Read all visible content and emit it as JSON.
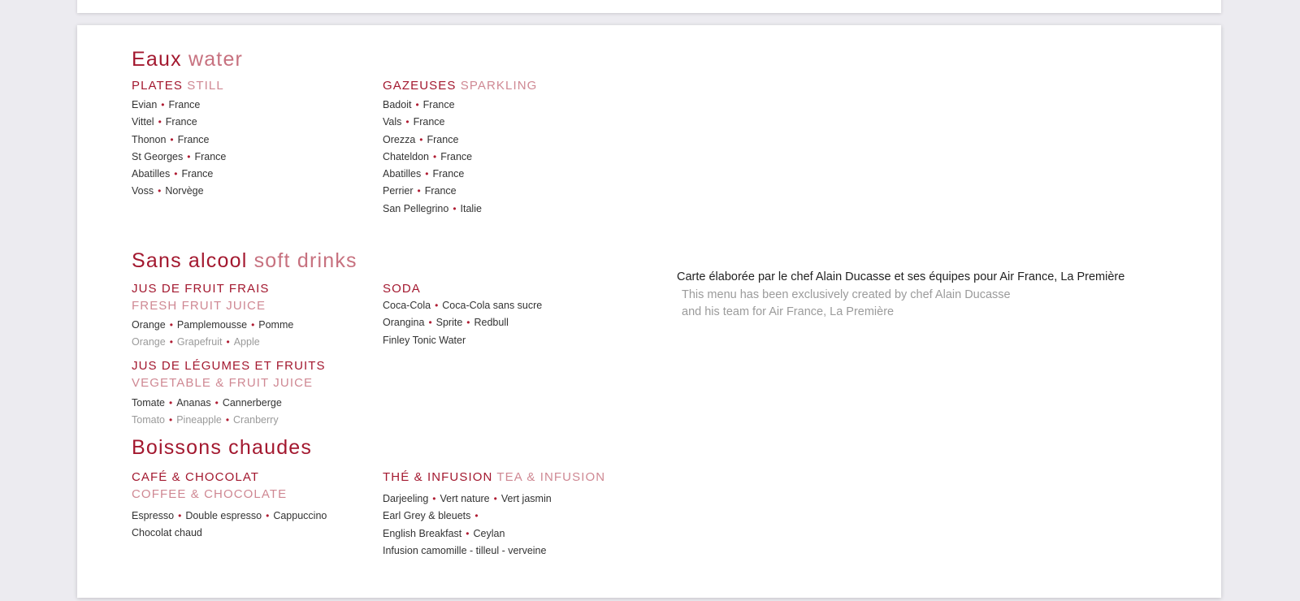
{
  "water": {
    "title_fr": "Eaux",
    "title_en": "water",
    "still": {
      "label_fr": "PLATES",
      "label_en": "STILL",
      "items": [
        {
          "name": "Evian",
          "origin": "France"
        },
        {
          "name": "Vittel",
          "origin": "France"
        },
        {
          "name": "Thonon",
          "origin": "France"
        },
        {
          "name": "St Georges",
          "origin": "France"
        },
        {
          "name": "Abatilles",
          "origin": "France"
        },
        {
          "name": "Voss",
          "origin": "Norvège"
        }
      ]
    },
    "sparkling": {
      "label_fr": "GAZEUSES",
      "label_en": "SPARKLING",
      "items": [
        {
          "name": "Badoit",
          "origin": "France"
        },
        {
          "name": "Vals",
          "origin": "France"
        },
        {
          "name": "Orezza",
          "origin": "France"
        },
        {
          "name": "Chateldon",
          "origin": "France"
        },
        {
          "name": "Abatilles",
          "origin": "France"
        },
        {
          "name": "Perrier",
          "origin": "France"
        },
        {
          "name": "San Pellegrino",
          "origin": "Italie"
        }
      ]
    }
  },
  "soft": {
    "title_fr": "Sans alcool",
    "title_en": "soft drinks",
    "fruit_juice": {
      "label_fr": "JUS DE FRUIT FRAIS",
      "label_en": "FRESH FRUIT JUICE",
      "items_fr": [
        "Orange",
        "Pamplemousse",
        "Pomme"
      ],
      "items_en": [
        "Orange",
        "Grapefruit",
        "Apple"
      ]
    },
    "veg_juice": {
      "label_fr": "JUS DE LÉGUMES ET FRUITS",
      "label_en": "VEGETABLE & FRUIT JUICE",
      "items_fr": [
        "Tomate",
        "Ananas",
        "Cannerberge"
      ],
      "items_en": [
        "Tomato",
        "Pineapple",
        "Cranberry"
      ]
    },
    "soda": {
      "label_fr": "SODA",
      "lines": [
        [
          "Coca-Cola",
          "Coca-Cola sans sucre"
        ],
        [
          "Orangina",
          "Sprite",
          "Redbull"
        ],
        [
          "Finley Tonic Water"
        ]
      ]
    }
  },
  "hot": {
    "title_fr": "Boissons chaudes",
    "coffee": {
      "label_fr": "CAFÉ & CHOCOLAT",
      "label_en": "COFFEE & CHOCOLATE",
      "lines": [
        [
          "Espresso",
          "Double espresso",
          "Cappuccino"
        ],
        [
          "Chocolat chaud"
        ]
      ]
    },
    "tea": {
      "label_fr": "THÉ & INFUSION",
      "label_en": "TEA & INFUSION",
      "lines": [
        [
          "Darjeeling",
          "Vert nature",
          "Vert jasmin"
        ],
        [
          "Earl Grey & bleuets",
          ""
        ],
        [
          "English Breakfast",
          "Ceylan"
        ],
        [
          "Infusion camomille - tilleul - verveine"
        ]
      ]
    }
  },
  "note": {
    "fr": "Carte élaborée par le chef Alain Ducasse et ses équipes pour Air France, La Première",
    "en_line1": "This menu has been exclusively created by chef Alain Ducasse",
    "en_line2": "and his team for Air France, La Première"
  },
  "colors": {
    "accent": "#a3182f",
    "accent_light": "#cf8893",
    "text": "#333333",
    "muted": "#9a9a9a",
    "background": "#ecebf0"
  }
}
